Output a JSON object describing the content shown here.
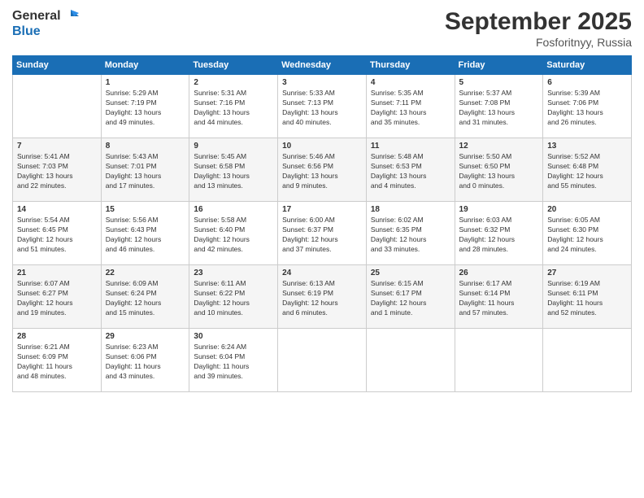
{
  "logo": {
    "line1": "General",
    "line2": "Blue"
  },
  "title": "September 2025",
  "location": "Fosforitnyy, Russia",
  "days_of_week": [
    "Sunday",
    "Monday",
    "Tuesday",
    "Wednesday",
    "Thursday",
    "Friday",
    "Saturday"
  ],
  "weeks": [
    [
      {
        "day": "",
        "info": ""
      },
      {
        "day": "1",
        "info": "Sunrise: 5:29 AM\nSunset: 7:19 PM\nDaylight: 13 hours\nand 49 minutes."
      },
      {
        "day": "2",
        "info": "Sunrise: 5:31 AM\nSunset: 7:16 PM\nDaylight: 13 hours\nand 44 minutes."
      },
      {
        "day": "3",
        "info": "Sunrise: 5:33 AM\nSunset: 7:13 PM\nDaylight: 13 hours\nand 40 minutes."
      },
      {
        "day": "4",
        "info": "Sunrise: 5:35 AM\nSunset: 7:11 PM\nDaylight: 13 hours\nand 35 minutes."
      },
      {
        "day": "5",
        "info": "Sunrise: 5:37 AM\nSunset: 7:08 PM\nDaylight: 13 hours\nand 31 minutes."
      },
      {
        "day": "6",
        "info": "Sunrise: 5:39 AM\nSunset: 7:06 PM\nDaylight: 13 hours\nand 26 minutes."
      }
    ],
    [
      {
        "day": "7",
        "info": "Sunrise: 5:41 AM\nSunset: 7:03 PM\nDaylight: 13 hours\nand 22 minutes."
      },
      {
        "day": "8",
        "info": "Sunrise: 5:43 AM\nSunset: 7:01 PM\nDaylight: 13 hours\nand 17 minutes."
      },
      {
        "day": "9",
        "info": "Sunrise: 5:45 AM\nSunset: 6:58 PM\nDaylight: 13 hours\nand 13 minutes."
      },
      {
        "day": "10",
        "info": "Sunrise: 5:46 AM\nSunset: 6:56 PM\nDaylight: 13 hours\nand 9 minutes."
      },
      {
        "day": "11",
        "info": "Sunrise: 5:48 AM\nSunset: 6:53 PM\nDaylight: 13 hours\nand 4 minutes."
      },
      {
        "day": "12",
        "info": "Sunrise: 5:50 AM\nSunset: 6:50 PM\nDaylight: 13 hours\nand 0 minutes."
      },
      {
        "day": "13",
        "info": "Sunrise: 5:52 AM\nSunset: 6:48 PM\nDaylight: 12 hours\nand 55 minutes."
      }
    ],
    [
      {
        "day": "14",
        "info": "Sunrise: 5:54 AM\nSunset: 6:45 PM\nDaylight: 12 hours\nand 51 minutes."
      },
      {
        "day": "15",
        "info": "Sunrise: 5:56 AM\nSunset: 6:43 PM\nDaylight: 12 hours\nand 46 minutes."
      },
      {
        "day": "16",
        "info": "Sunrise: 5:58 AM\nSunset: 6:40 PM\nDaylight: 12 hours\nand 42 minutes."
      },
      {
        "day": "17",
        "info": "Sunrise: 6:00 AM\nSunset: 6:37 PM\nDaylight: 12 hours\nand 37 minutes."
      },
      {
        "day": "18",
        "info": "Sunrise: 6:02 AM\nSunset: 6:35 PM\nDaylight: 12 hours\nand 33 minutes."
      },
      {
        "day": "19",
        "info": "Sunrise: 6:03 AM\nSunset: 6:32 PM\nDaylight: 12 hours\nand 28 minutes."
      },
      {
        "day": "20",
        "info": "Sunrise: 6:05 AM\nSunset: 6:30 PM\nDaylight: 12 hours\nand 24 minutes."
      }
    ],
    [
      {
        "day": "21",
        "info": "Sunrise: 6:07 AM\nSunset: 6:27 PM\nDaylight: 12 hours\nand 19 minutes."
      },
      {
        "day": "22",
        "info": "Sunrise: 6:09 AM\nSunset: 6:24 PM\nDaylight: 12 hours\nand 15 minutes."
      },
      {
        "day": "23",
        "info": "Sunrise: 6:11 AM\nSunset: 6:22 PM\nDaylight: 12 hours\nand 10 minutes."
      },
      {
        "day": "24",
        "info": "Sunrise: 6:13 AM\nSunset: 6:19 PM\nDaylight: 12 hours\nand 6 minutes."
      },
      {
        "day": "25",
        "info": "Sunrise: 6:15 AM\nSunset: 6:17 PM\nDaylight: 12 hours\nand 1 minute."
      },
      {
        "day": "26",
        "info": "Sunrise: 6:17 AM\nSunset: 6:14 PM\nDaylight: 11 hours\nand 57 minutes."
      },
      {
        "day": "27",
        "info": "Sunrise: 6:19 AM\nSunset: 6:11 PM\nDaylight: 11 hours\nand 52 minutes."
      }
    ],
    [
      {
        "day": "28",
        "info": "Sunrise: 6:21 AM\nSunset: 6:09 PM\nDaylight: 11 hours\nand 48 minutes."
      },
      {
        "day": "29",
        "info": "Sunrise: 6:23 AM\nSunset: 6:06 PM\nDaylight: 11 hours\nand 43 minutes."
      },
      {
        "day": "30",
        "info": "Sunrise: 6:24 AM\nSunset: 6:04 PM\nDaylight: 11 hours\nand 39 minutes."
      },
      {
        "day": "",
        "info": ""
      },
      {
        "day": "",
        "info": ""
      },
      {
        "day": "",
        "info": ""
      },
      {
        "day": "",
        "info": ""
      }
    ]
  ]
}
